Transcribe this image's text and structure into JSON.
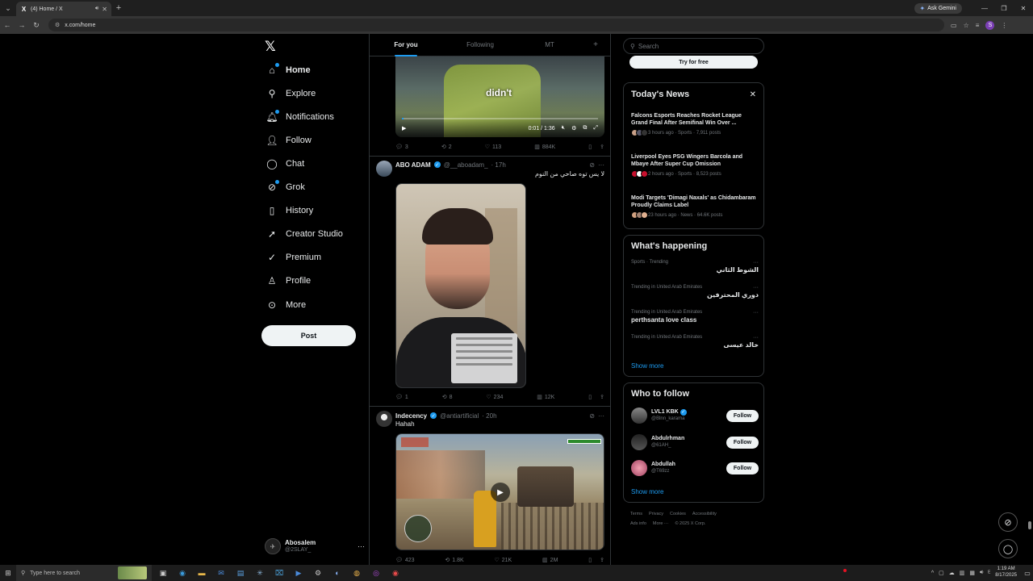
{
  "browser": {
    "tab_title": "(4) Home / X",
    "url": "x.com/home",
    "gemini_label": "Ask Gemini",
    "profile_initial": "S"
  },
  "nav": {
    "logo": "𝕏",
    "items": [
      {
        "label": "Home",
        "icon": "home-icon"
      },
      {
        "label": "Explore",
        "icon": "search-icon"
      },
      {
        "label": "Notifications",
        "icon": "bell-icon"
      },
      {
        "label": "Follow",
        "icon": "person-add-icon"
      },
      {
        "label": "Chat",
        "icon": "chat-icon"
      },
      {
        "label": "Grok",
        "icon": "grok-icon"
      },
      {
        "label": "History",
        "icon": "bookmark-icon"
      },
      {
        "label": "Creator Studio",
        "icon": "rocket-icon"
      },
      {
        "label": "Premium",
        "icon": "premium-icon"
      },
      {
        "label": "Profile",
        "icon": "person-icon"
      },
      {
        "label": "More",
        "icon": "more-circle-icon"
      }
    ],
    "post_label": "Post",
    "account": {
      "name": "Abosalem",
      "handle": "@2SLAY_"
    }
  },
  "feed": {
    "tabs": [
      "For you",
      "Following",
      "MT"
    ],
    "video1": {
      "caption": "didn't",
      "time": "0:01 / 1:36",
      "progress": 0.01,
      "stats": {
        "replies": "3",
        "reposts": "2",
        "likes": "113",
        "views": "884K"
      }
    },
    "tweet2": {
      "name": "ABO ADAM",
      "handle": "@__aboadam_",
      "time": "· 17h",
      "text": "لا يس توه صاحي من النوم",
      "stats": {
        "replies": "1",
        "reposts": "8",
        "likes": "234",
        "views": "12K"
      }
    },
    "tweet3": {
      "name": "Indecency",
      "handle": "@antiartificial",
      "time": "· 20h",
      "text": "Hahah",
      "stats": {
        "replies": "423",
        "reposts": "1.8K",
        "likes": "21K",
        "views": "2M"
      }
    }
  },
  "right": {
    "search_placeholder": "Search",
    "try_label": "Try for free",
    "news_title": "Today's News",
    "news": [
      {
        "headline": "Falcons Esports Reaches Rocket League Grand Final After Semifinal Win Over ...",
        "meta": "3 hours ago · Sports · 7,911 posts"
      },
      {
        "headline": "Liverpool Eyes PSG Wingers Barcola and Mbaye After Super Cup Omission",
        "meta": "2 hours ago · Sports · 8,523 posts"
      },
      {
        "headline": "Modi Targets 'Dimagi Naxals' as Chidambaram Proudly Claims Label",
        "meta": "23 hours ago · News · 64.6K posts"
      }
    ],
    "happening_title": "What's happening",
    "trends": [
      {
        "category": "Sports · Trending",
        "name": "الشوط الثاني",
        "rtl": true
      },
      {
        "category": "Trending in United Arab Emirates",
        "name": "دوري المحترفين",
        "rtl": true
      },
      {
        "category": "Trending in United Arab Emirates",
        "name": "perthsanta love class",
        "rtl": false
      },
      {
        "category": "Trending in United Arab Emirates",
        "name": "خالد عيسى",
        "rtl": true
      }
    ],
    "show_more": "Show more",
    "who_title": "Who to follow",
    "follow": [
      {
        "name": "LVL1 KBK",
        "handle": "@Blnn_karama",
        "verified": true
      },
      {
        "name": "Abdulrhman",
        "handle": "@61AH_",
        "verified": false
      },
      {
        "name": "Abdullah",
        "handle": "@T69zz",
        "verified": false
      }
    ],
    "follow_label": "Follow",
    "footer": [
      "Terms",
      "Privacy",
      "Cookies",
      "Accessibility",
      "Ads info",
      "More ···",
      "© 2025 X Corp."
    ]
  },
  "taskbar": {
    "search_placeholder": "Type here to search",
    "time": "1:19 AM",
    "date": "8/17/2025"
  }
}
